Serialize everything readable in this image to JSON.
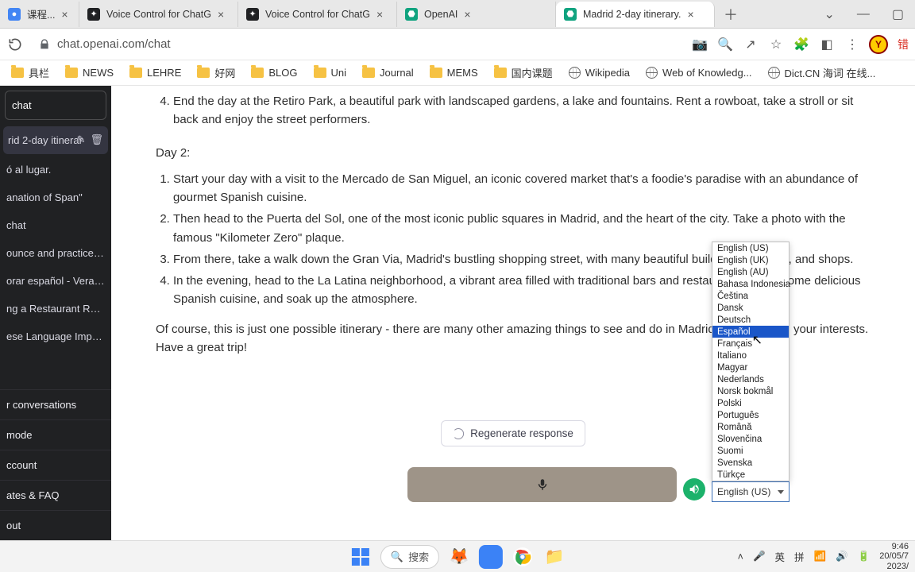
{
  "browser": {
    "tabs": [
      {
        "title": "课程...",
        "color": "#4285f4"
      },
      {
        "title": "Voice Control for ChatG",
        "color": "#202123"
      },
      {
        "title": "Voice Control for ChatG",
        "color": "#202123"
      },
      {
        "title": "OpenAI",
        "color": "#10a37f"
      },
      {
        "title": "Madrid 2-day itinerary.",
        "color": "#10a37f",
        "active": true
      }
    ],
    "url": "chat.openai.com/chat",
    "avatar_letter": "Y",
    "avatar_badge": "错"
  },
  "bookmarks": [
    {
      "label": "具栏",
      "type": "folder"
    },
    {
      "label": "NEWS",
      "type": "folder"
    },
    {
      "label": "LEHRE",
      "type": "folder"
    },
    {
      "label": "好网",
      "type": "folder"
    },
    {
      "label": "BLOG",
      "type": "folder"
    },
    {
      "label": "Uni",
      "type": "folder"
    },
    {
      "label": "Journal",
      "type": "folder"
    },
    {
      "label": "MEMS",
      "type": "folder"
    },
    {
      "label": "国内课题",
      "type": "folder"
    },
    {
      "label": "Wikipedia",
      "type": "globe"
    },
    {
      "label": "Web of Knowledg...",
      "type": "globe"
    },
    {
      "label": "Dict.CN 海词 在线...",
      "type": "globe"
    }
  ],
  "sidebar": {
    "new_chat": "chat",
    "selected": "rid 2-day itinerar",
    "items": [
      "ó al lugar.",
      "anation of Span\"",
      "chat",
      "ounce and practice Spa",
      "orar español - Verano",
      "ng a Restaurant Reserv",
      "ese Language Importan"
    ],
    "footer": [
      "r conversations",
      "mode",
      "ccount",
      "ates & FAQ",
      "out"
    ]
  },
  "chat": {
    "day1_item4": "End the day at the Retiro Park, a beautiful park with landscaped gardens, a lake and fountains. Rent a rowboat, take a stroll or sit back and enjoy the street performers.",
    "day2_label": "Day 2:",
    "day2_items": [
      "Start your day with a visit to the Mercado de San Miguel, an iconic covered market that's a foodie's paradise with an abundance of gourmet Spanish cuisine.",
      "Then head to the Puerta del Sol, one of the most iconic public squares in Madrid, and the heart of the city. Take a photo with the famous \"Kilometer Zero\" plaque.",
      "From there, take a walk down the Gran Via, Madrid's bustling shopping street, with many beautiful buildings, theaters, and shops.",
      "In the evening, head to the La Latina neighborhood, a vibrant area filled with traditional bars and restaurants. Enjoy some delicious Spanish cuisine, and soak up the atmosphere."
    ],
    "closing": "Of course, this is just one possible itinerary - there are many other amazing things to see and do in Madrid depending on your interests. Have a great trip!",
    "regenerate": "Regenerate response"
  },
  "voice": {
    "selected_lang": "English (US)",
    "options": [
      "English (US)",
      "English (UK)",
      "English (AU)",
      "Bahasa Indonesia",
      "Čeština",
      "Dansk",
      "Deutsch",
      "Español",
      "Français",
      "Italiano",
      "Magyar",
      "Nederlands",
      "Norsk bokmål",
      "Polski",
      "Português",
      "Română",
      "Slovenčina",
      "Suomi",
      "Svenska",
      "Türkçe"
    ],
    "highlight_index": 7
  },
  "taskbar": {
    "search": "搜索",
    "ime1": "英",
    "ime2": "拼",
    "time": "9:46",
    "date_small": "20/05/7",
    "date_year": "2023/"
  }
}
